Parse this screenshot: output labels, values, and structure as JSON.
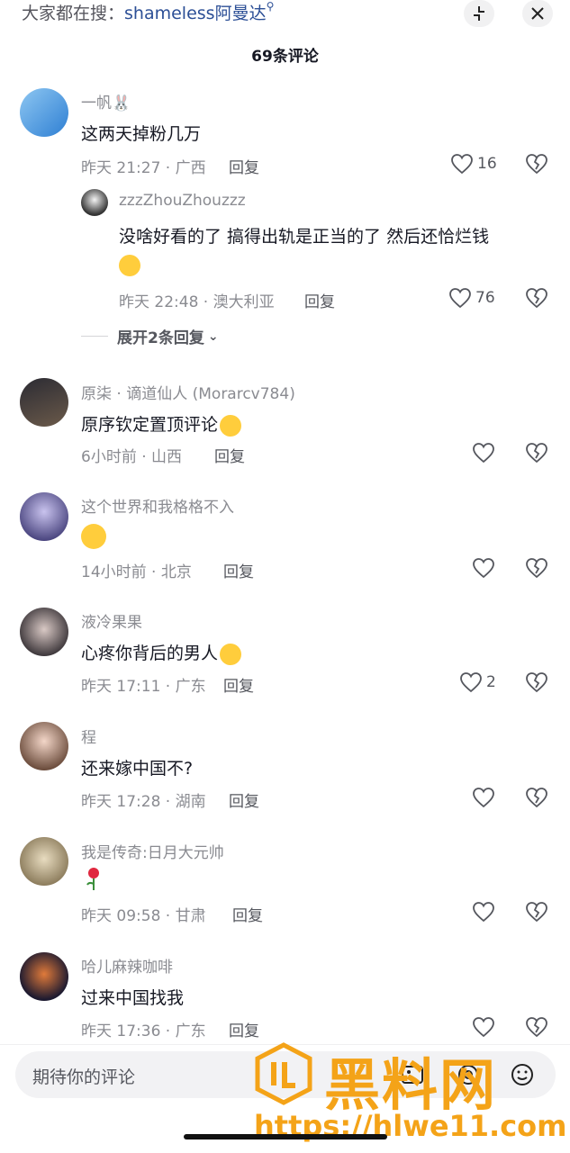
{
  "header": {
    "search_prefix": "大家都在搜：",
    "search_keyword": "shameless阿曼达",
    "comment_count_title": "69条评论"
  },
  "comments": [
    {
      "name": "一帆🐰",
      "text": "这两天掉粉几万",
      "time": "昨天 21:27 · 广西",
      "reply": "回复",
      "likes": "16"
    },
    {
      "name": "zzzZhouZhouzzz",
      "text": "没啥好看的了 搞得出轨是正当的了 然后还恰烂钱",
      "time": "昨天 22:48 · 澳大利亚",
      "reply": "回复",
      "likes": "76"
    },
    {
      "name": "原柒 · 谪道仙人 (Morarcv784)",
      "text": "原序钦定置顶评论",
      "time": "6小时前 · 山西",
      "reply": "回复",
      "likes": ""
    },
    {
      "name": "这个世界和我格格不入",
      "text": "",
      "time": "14小时前 · 北京",
      "reply": "回复",
      "likes": ""
    },
    {
      "name": "液冷果果",
      "text": "心疼你背后的男人",
      "time": "昨天 17:11 · 广东",
      "reply": "回复",
      "likes": "2"
    },
    {
      "name": "程",
      "text": "还来嫁中国不?",
      "time": "昨天 17:28 · 湖南",
      "reply": "回复",
      "likes": ""
    },
    {
      "name": "我是传奇:日月大元帅",
      "text": "",
      "time": "昨天 09:58 · 甘肃",
      "reply": "回复",
      "likes": ""
    },
    {
      "name": "哈儿麻辣咖啡",
      "text": "过来中国找我",
      "time": "昨天 17:36 · 广东",
      "reply": "回复",
      "likes": ""
    }
  ],
  "expand_replies": "展开2条回复",
  "input_placeholder": "期待你的评论",
  "watermark": {
    "text": "黑料网",
    "url": "https://hlwe11.com"
  },
  "colors": {
    "accent_link": "#2c4f96",
    "watermark": "#f4a318"
  }
}
